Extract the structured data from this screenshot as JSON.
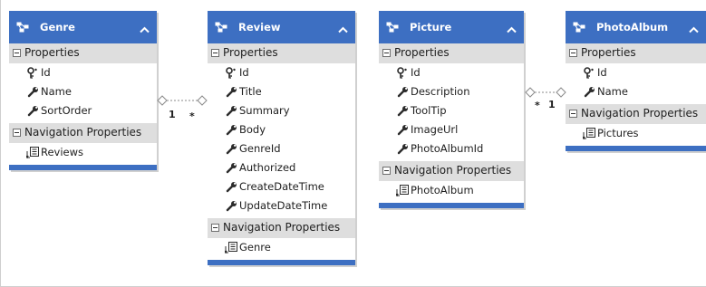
{
  "entities": [
    {
      "name": "Genre",
      "properties_header": "Properties",
      "properties": [
        {
          "label": "Id",
          "icon": "key-icon"
        },
        {
          "label": "Name",
          "icon": "wrench-icon"
        },
        {
          "label": "SortOrder",
          "icon": "wrench-icon"
        }
      ],
      "navigation_header": "Navigation Properties",
      "navigation": [
        {
          "label": "Reviews",
          "icon": "navigation-property-icon"
        }
      ]
    },
    {
      "name": "Review",
      "properties_header": "Properties",
      "properties": [
        {
          "label": "Id",
          "icon": "key-icon"
        },
        {
          "label": "Title",
          "icon": "wrench-icon"
        },
        {
          "label": "Summary",
          "icon": "wrench-icon"
        },
        {
          "label": "Body",
          "icon": "wrench-icon"
        },
        {
          "label": "GenreId",
          "icon": "wrench-icon"
        },
        {
          "label": "Authorized",
          "icon": "wrench-icon"
        },
        {
          "label": "CreateDateTime",
          "icon": "wrench-icon"
        },
        {
          "label": "UpdateDateTime",
          "icon": "wrench-icon"
        }
      ],
      "navigation_header": "Navigation Properties",
      "navigation": [
        {
          "label": "Genre",
          "icon": "navigation-property-icon"
        }
      ]
    },
    {
      "name": "Picture",
      "properties_header": "Properties",
      "properties": [
        {
          "label": "Id",
          "icon": "key-icon"
        },
        {
          "label": "Description",
          "icon": "wrench-icon"
        },
        {
          "label": "ToolTip",
          "icon": "wrench-icon"
        },
        {
          "label": "ImageUrl",
          "icon": "wrench-icon"
        },
        {
          "label": "PhotoAlbumId",
          "icon": "wrench-icon"
        }
      ],
      "navigation_header": "Navigation Properties",
      "navigation": [
        {
          "label": "PhotoAlbum",
          "icon": "navigation-property-icon"
        }
      ]
    },
    {
      "name": "PhotoAlbum",
      "properties_header": "Properties",
      "properties": [
        {
          "label": "Id",
          "icon": "key-icon"
        },
        {
          "label": "Name",
          "icon": "wrench-icon"
        }
      ],
      "navigation_header": "Navigation Properties",
      "navigation": [
        {
          "label": "Pictures",
          "icon": "navigation-property-icon"
        }
      ]
    }
  ],
  "associations": [
    {
      "end_left": "1",
      "end_right": "*"
    },
    {
      "end_left": "*",
      "end_right": "1"
    }
  ],
  "colors": {
    "header": "#3d6fc2",
    "section": "#dedede",
    "body": "#ffffff"
  }
}
